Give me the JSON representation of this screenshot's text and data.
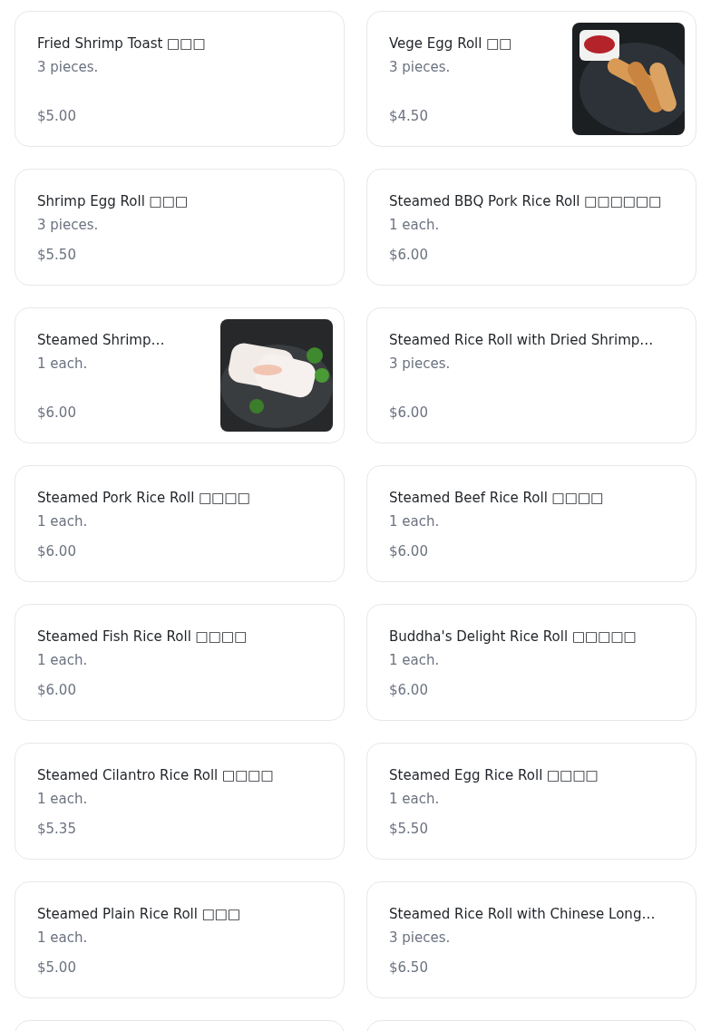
{
  "items": [
    {
      "kind": "plain",
      "name": "Fried Shrimp Toast □□□",
      "description": "3 pieces.",
      "price": "$5.00"
    },
    {
      "kind": "with-picture",
      "name": "Vege Egg Roll □□",
      "description": "3 pieces.",
      "price": "$4.50"
    },
    {
      "kind": "plain",
      "name": "Shrimp Egg Roll □□□",
      "description": "3 pieces.",
      "price": "$5.50"
    },
    {
      "kind": "plain",
      "name": "Steamed BBQ Pork Rice Roll □□□□□□",
      "description": "1 each.",
      "price": "$6.00"
    },
    {
      "kind": "with-picture",
      "name": "Steamed Shrimp…",
      "description": "1 each.",
      "price": "$6.00"
    },
    {
      "kind": "plain",
      "name": "Steamed Rice Roll with Dried Shrimp…",
      "description": "3 pieces.",
      "price": "$6.00"
    },
    {
      "kind": "plain",
      "name": "Steamed Pork Rice Roll □□□□",
      "description": "1 each.",
      "price": "$6.00"
    },
    {
      "kind": "plain",
      "name": "Steamed Beef Rice Roll □□□□",
      "description": "1 each.",
      "price": "$6.00"
    },
    {
      "kind": "plain",
      "name": "Steamed Fish Rice Roll □□□□",
      "description": "1 each.",
      "price": "$6.00"
    },
    {
      "kind": "plain",
      "name": "Buddha's Delight Rice Roll □□□□□",
      "description": "1 each.",
      "price": "$6.00"
    },
    {
      "kind": "plain",
      "name": "Steamed Cilantro Rice Roll □□□□",
      "description": "1 each.",
      "price": "$5.35"
    },
    {
      "kind": "plain",
      "name": "Steamed Egg Rice Roll □□□□",
      "description": "1 each.",
      "price": "$5.50"
    },
    {
      "kind": "plain",
      "name": "Steamed Plain Rice Roll □□□",
      "description": "1 each.",
      "price": "$5.00"
    },
    {
      "kind": "plain",
      "name": "Steamed Rice Roll with Chinese Long…",
      "description": "3 pieces.",
      "price": "$6.50"
    },
    {
      "kind": "empty"
    },
    {
      "kind": "empty"
    }
  ]
}
